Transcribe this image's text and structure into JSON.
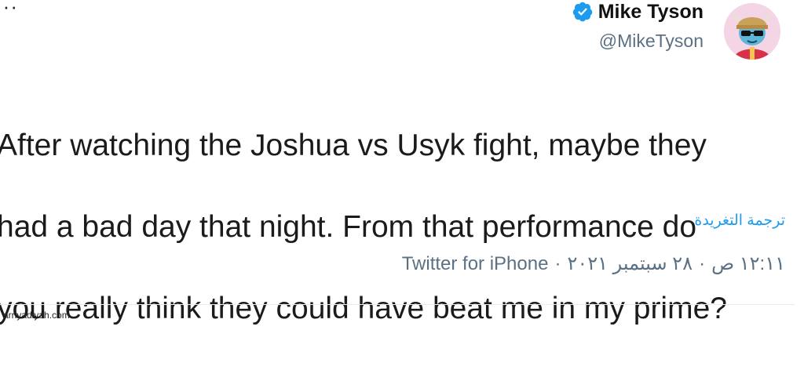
{
  "header": {
    "more_label": "···",
    "display_name": "Mike Tyson",
    "handle": "@MikeTyson",
    "verified_color": "#1d9bf0"
  },
  "tweet": {
    "lines": [
      "After watching the Joshua vs Usyk fight, maybe they",
      "had a bad day that night.  From that performance do",
      "you really think they could have beat me in my prime?"
    ],
    "translate_label": "ترجمة التغريدة"
  },
  "meta": {
    "time": "١٢:١١ ص",
    "date": "٢٨ سبتمبر ٢٠٢١",
    "source": "Twitter for iPhone",
    "separator": "·"
  },
  "footer": {
    "watermark": "arriyadiyah.com"
  },
  "colors": {
    "link": "#1d9bf0",
    "secondary_text": "#5b7083"
  },
  "icons": [
    "more-icon",
    "verified-icon",
    "avatar"
  ]
}
